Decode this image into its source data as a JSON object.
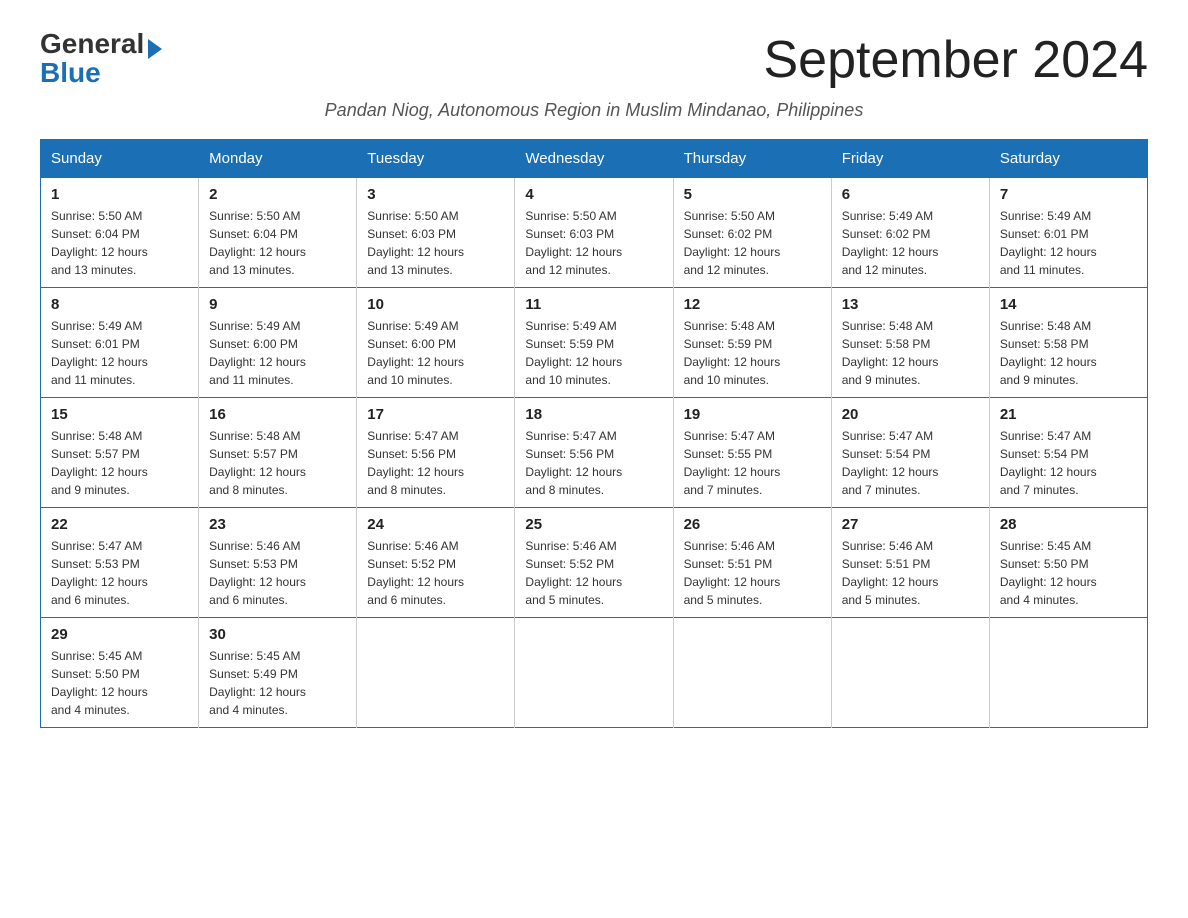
{
  "logo": {
    "general": "General",
    "blue": "Blue"
  },
  "title": "September 2024",
  "subtitle": "Pandan Niog, Autonomous Region in Muslim Mindanao, Philippines",
  "headers": [
    "Sunday",
    "Monday",
    "Tuesday",
    "Wednesday",
    "Thursday",
    "Friday",
    "Saturday"
  ],
  "weeks": [
    [
      {
        "day": "1",
        "sunrise": "5:50 AM",
        "sunset": "6:04 PM",
        "daylight": "12 hours and 13 minutes."
      },
      {
        "day": "2",
        "sunrise": "5:50 AM",
        "sunset": "6:04 PM",
        "daylight": "12 hours and 13 minutes."
      },
      {
        "day": "3",
        "sunrise": "5:50 AM",
        "sunset": "6:03 PM",
        "daylight": "12 hours and 13 minutes."
      },
      {
        "day": "4",
        "sunrise": "5:50 AM",
        "sunset": "6:03 PM",
        "daylight": "12 hours and 12 minutes."
      },
      {
        "day": "5",
        "sunrise": "5:50 AM",
        "sunset": "6:02 PM",
        "daylight": "12 hours and 12 minutes."
      },
      {
        "day": "6",
        "sunrise": "5:49 AM",
        "sunset": "6:02 PM",
        "daylight": "12 hours and 12 minutes."
      },
      {
        "day": "7",
        "sunrise": "5:49 AM",
        "sunset": "6:01 PM",
        "daylight": "12 hours and 11 minutes."
      }
    ],
    [
      {
        "day": "8",
        "sunrise": "5:49 AM",
        "sunset": "6:01 PM",
        "daylight": "12 hours and 11 minutes."
      },
      {
        "day": "9",
        "sunrise": "5:49 AM",
        "sunset": "6:00 PM",
        "daylight": "12 hours and 11 minutes."
      },
      {
        "day": "10",
        "sunrise": "5:49 AM",
        "sunset": "6:00 PM",
        "daylight": "12 hours and 10 minutes."
      },
      {
        "day": "11",
        "sunrise": "5:49 AM",
        "sunset": "5:59 PM",
        "daylight": "12 hours and 10 minutes."
      },
      {
        "day": "12",
        "sunrise": "5:48 AM",
        "sunset": "5:59 PM",
        "daylight": "12 hours and 10 minutes."
      },
      {
        "day": "13",
        "sunrise": "5:48 AM",
        "sunset": "5:58 PM",
        "daylight": "12 hours and 9 minutes."
      },
      {
        "day": "14",
        "sunrise": "5:48 AM",
        "sunset": "5:58 PM",
        "daylight": "12 hours and 9 minutes."
      }
    ],
    [
      {
        "day": "15",
        "sunrise": "5:48 AM",
        "sunset": "5:57 PM",
        "daylight": "12 hours and 9 minutes."
      },
      {
        "day": "16",
        "sunrise": "5:48 AM",
        "sunset": "5:57 PM",
        "daylight": "12 hours and 8 minutes."
      },
      {
        "day": "17",
        "sunrise": "5:47 AM",
        "sunset": "5:56 PM",
        "daylight": "12 hours and 8 minutes."
      },
      {
        "day": "18",
        "sunrise": "5:47 AM",
        "sunset": "5:56 PM",
        "daylight": "12 hours and 8 minutes."
      },
      {
        "day": "19",
        "sunrise": "5:47 AM",
        "sunset": "5:55 PM",
        "daylight": "12 hours and 7 minutes."
      },
      {
        "day": "20",
        "sunrise": "5:47 AM",
        "sunset": "5:54 PM",
        "daylight": "12 hours and 7 minutes."
      },
      {
        "day": "21",
        "sunrise": "5:47 AM",
        "sunset": "5:54 PM",
        "daylight": "12 hours and 7 minutes."
      }
    ],
    [
      {
        "day": "22",
        "sunrise": "5:47 AM",
        "sunset": "5:53 PM",
        "daylight": "12 hours and 6 minutes."
      },
      {
        "day": "23",
        "sunrise": "5:46 AM",
        "sunset": "5:53 PM",
        "daylight": "12 hours and 6 minutes."
      },
      {
        "day": "24",
        "sunrise": "5:46 AM",
        "sunset": "5:52 PM",
        "daylight": "12 hours and 6 minutes."
      },
      {
        "day": "25",
        "sunrise": "5:46 AM",
        "sunset": "5:52 PM",
        "daylight": "12 hours and 5 minutes."
      },
      {
        "day": "26",
        "sunrise": "5:46 AM",
        "sunset": "5:51 PM",
        "daylight": "12 hours and 5 minutes."
      },
      {
        "day": "27",
        "sunrise": "5:46 AM",
        "sunset": "5:51 PM",
        "daylight": "12 hours and 5 minutes."
      },
      {
        "day": "28",
        "sunrise": "5:45 AM",
        "sunset": "5:50 PM",
        "daylight": "12 hours and 4 minutes."
      }
    ],
    [
      {
        "day": "29",
        "sunrise": "5:45 AM",
        "sunset": "5:50 PM",
        "daylight": "12 hours and 4 minutes."
      },
      {
        "day": "30",
        "sunrise": "5:45 AM",
        "sunset": "5:49 PM",
        "daylight": "12 hours and 4 minutes."
      },
      null,
      null,
      null,
      null,
      null
    ]
  ],
  "labels": {
    "sunrise": "Sunrise:",
    "sunset": "Sunset:",
    "daylight": "Daylight:"
  }
}
